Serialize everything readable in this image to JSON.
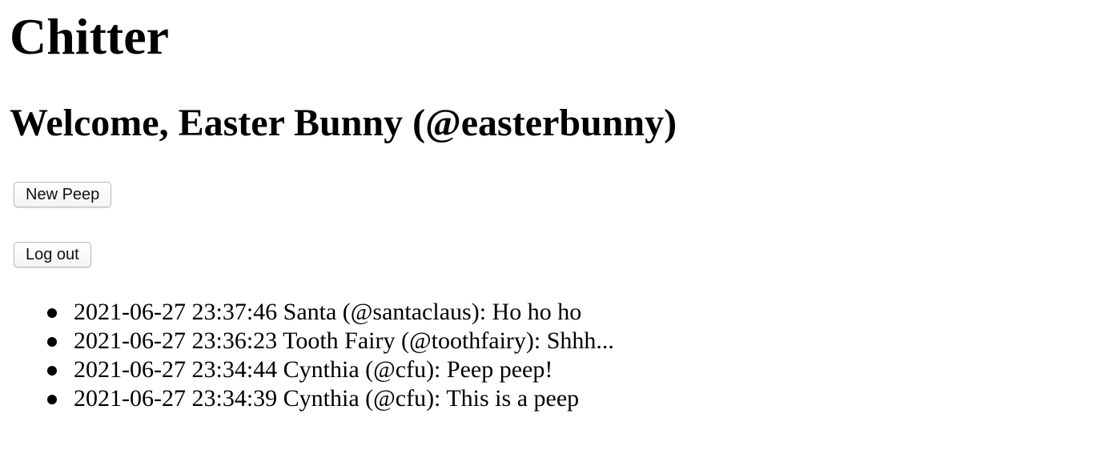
{
  "app": {
    "title": "Chitter"
  },
  "welcome": {
    "text": "Welcome, Easter Bunny (@easterbunny)"
  },
  "actions": {
    "new_peep_label": "New Peep",
    "logout_label": "Log out"
  },
  "peeps": [
    {
      "text": "2021-06-27 23:37:46 Santa (@santaclaus): Ho ho ho"
    },
    {
      "text": "2021-06-27 23:36:23 Tooth Fairy (@toothfairy): Shhh..."
    },
    {
      "text": "2021-06-27 23:34:44 Cynthia (@cfu): Peep peep!"
    },
    {
      "text": "2021-06-27 23:34:39 Cynthia (@cfu): This is a peep"
    }
  ]
}
